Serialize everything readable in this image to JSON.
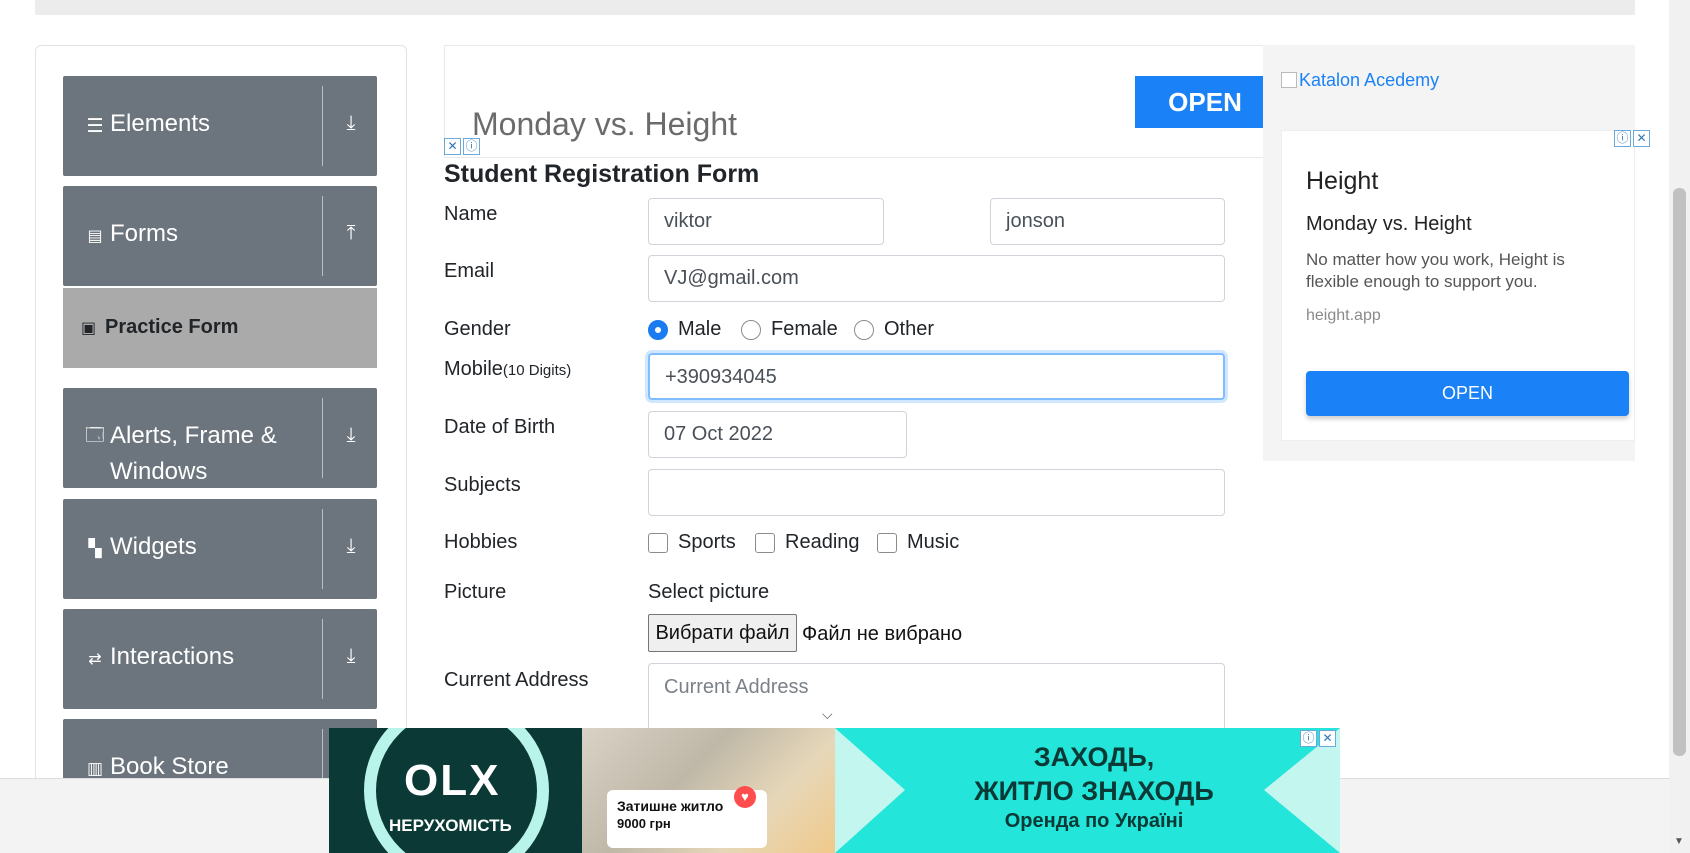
{
  "sidebar": {
    "groups": [
      {
        "label": "Elements",
        "icon": "hamburger-icon",
        "arrow": "download-arrow-icon"
      },
      {
        "label": "Forms",
        "icon": "document-icon",
        "arrow": "upload-arrow-icon"
      },
      {
        "label": "Alerts, Frame &",
        "label2": "Windows",
        "icon": "window-icon",
        "arrow": "download-arrow-icon"
      },
      {
        "label": "Widgets",
        "icon": "widgets-icon",
        "arrow": "download-arrow-icon"
      },
      {
        "label": "Interactions",
        "icon": "interactions-icon",
        "arrow": "download-arrow-icon"
      },
      {
        "label": "Book Store",
        "icon": "books-icon"
      }
    ],
    "active_item": {
      "label": "Practice Form",
      "icon": "html5-icon"
    }
  },
  "top_ad": {
    "headline": "Monday vs. Height",
    "open_label": "OPEN"
  },
  "form": {
    "title": "Student Registration Form",
    "name_label": "Name",
    "first_name": "viktor",
    "last_name": "jonson",
    "email_label": "Email",
    "email": "VJ@gmail.com",
    "gender_label": "Gender",
    "genders": [
      "Male",
      "Female",
      "Other"
    ],
    "gender_selected": "Male",
    "mobile_label": "Mobile",
    "mobile_hint": "(10 Digits)",
    "mobile": "+390934045",
    "dob_label": "Date of Birth",
    "dob": "07 Oct 2022",
    "subjects_label": "Subjects",
    "subjects": "",
    "hobbies_label": "Hobbies",
    "hobbies": [
      "Sports",
      "Reading",
      "Music"
    ],
    "picture_label": "Picture",
    "select_picture": "Select picture",
    "file_button": "Вибрати файл",
    "file_status": "Файл не вибрано",
    "address_label": "Current Address",
    "address_placeholder": "Current Address"
  },
  "right_ad": {
    "link_text": "Katalon Acedemy",
    "title": "Height",
    "subtitle": "Monday vs. Height",
    "body": "No matter how you work, Height is flexible enough to support you.",
    "domain": "height.app",
    "open_label": "OPEN"
  },
  "banner": {
    "logo": "OLX",
    "logo_sub": "НЕРУХОМІСТЬ",
    "card_line1": "Затишне житло",
    "card_line2": "9000 грн",
    "line1": "ЗАХОДЬ,",
    "line2": "ЖИТЛО ЗНАХОДЬ",
    "line3": "Оренда по Україні"
  },
  "adchoices": {
    "info": "ⓘ",
    "close": "✕"
  }
}
